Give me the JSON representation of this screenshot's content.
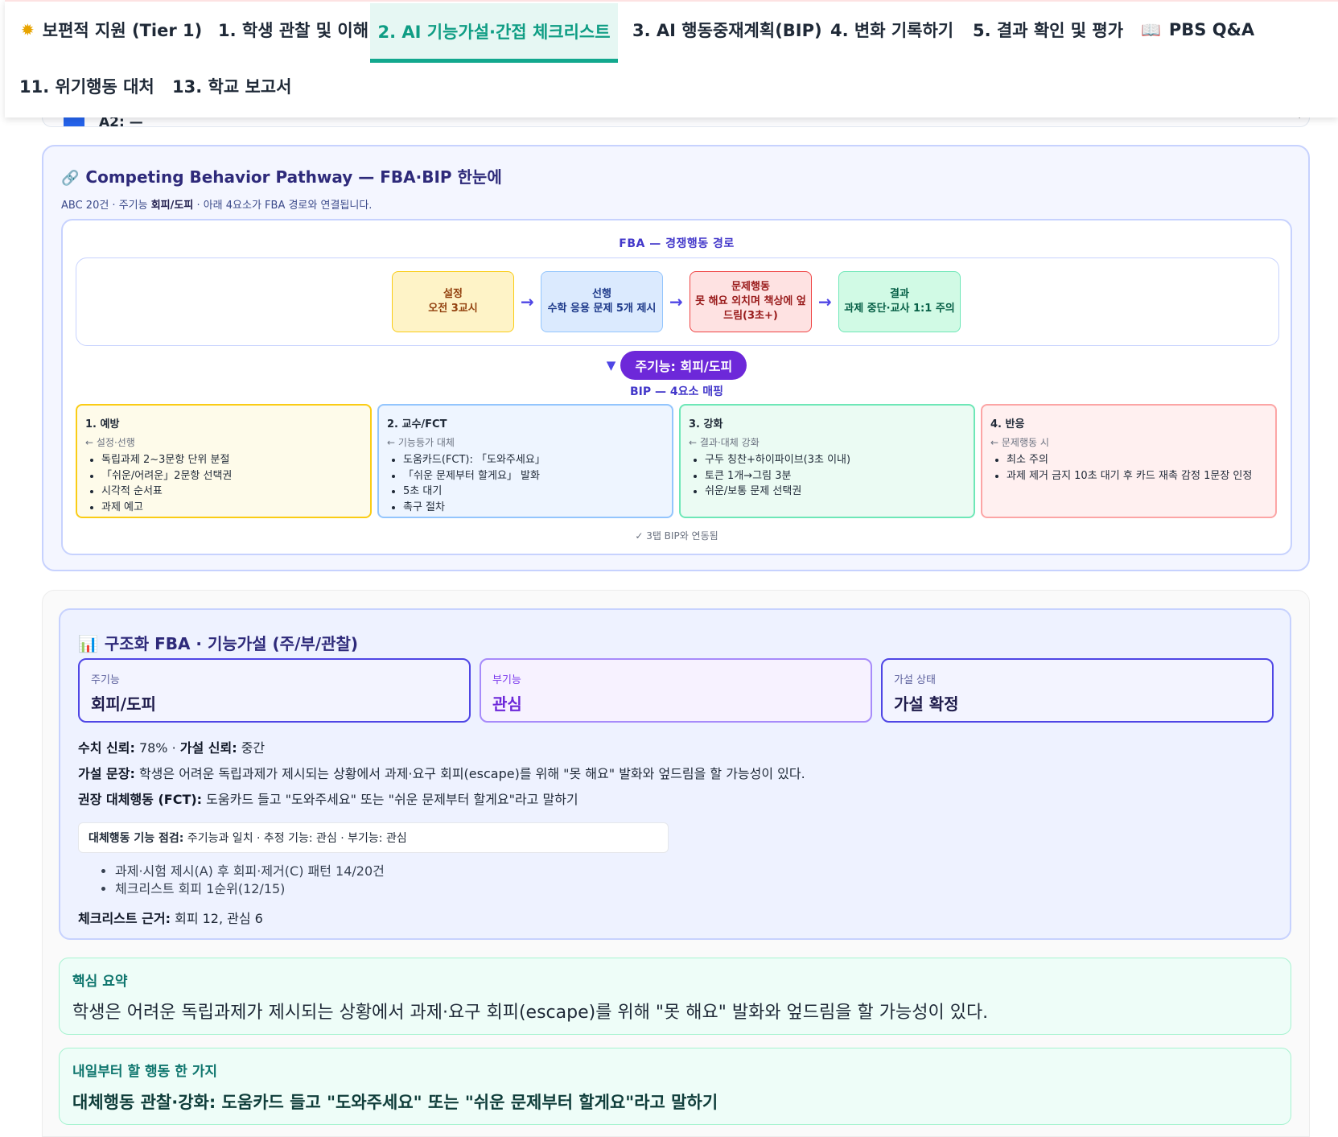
{
  "tabs": [
    {
      "label": "보편적 지원 (Tier 1)",
      "icon": "sun-icon"
    },
    {
      "label": "1. 학생 관찰 및 이해"
    },
    {
      "label": "2. AI 기능가설·간접 체크리스트",
      "active": true
    },
    {
      "label": "3. AI 행동중재계획(BIP)"
    },
    {
      "label": "4. 변화 기록하기"
    },
    {
      "label": "5. 결과 확인 및 평가"
    },
    {
      "label": "PBS Q&A",
      "icon": "book-icon"
    },
    {
      "label": "11. 위기행동 대처"
    },
    {
      "label": "13. 학교 보고서"
    }
  ],
  "peek_row": {
    "label": "A2: —"
  },
  "pathway": {
    "title": "Competing Behavior Pathway — FBA·BIP 한눈에",
    "subtitle_prefix": "ABC 20건 · 주기능 ",
    "subtitle_function": "회피/도피",
    "subtitle_suffix": " · 아래 4요소가 FBA 경로와 연결됩니다.",
    "fba_label": "FBA — 경쟁행동 경로",
    "chain": [
      {
        "title": "설정",
        "text": "오전 3교시"
      },
      {
        "title": "선행",
        "text": "수학 응용 문제 5개 제시"
      },
      {
        "title": "문제행동",
        "text": "못 해요 외치며 책상에 엎드림(3초+)"
      },
      {
        "title": "결과",
        "text": "과제 중단·교사 1:1 주의"
      }
    ],
    "arrow": "→",
    "function_pill": "주기능: 회피/도피",
    "bip_label": "BIP — 4요소 매핑",
    "bip": [
      {
        "title": "1. 예방",
        "from": "← 설정·선행",
        "items": [
          "독립과제 2~3문항 단위 분절",
          "「쉬운/어려운」2문항 선택권",
          "시각적 순서표",
          "과제 예고"
        ]
      },
      {
        "title": "2. 교수/FCT",
        "from": "← 기능등가 대체",
        "items": [
          "도움카드(FCT): 「도와주세요」",
          "「쉬운 문제부터 할게요」 발화",
          "5초 대기",
          "촉구 절차"
        ]
      },
      {
        "title": "3. 강화",
        "from": "← 결과·대체 강화",
        "items": [
          "구두 칭찬+하이파이브(3초 이내)",
          "토큰 1개→그림 3분",
          "쉬운/보통 문제 선택권"
        ]
      },
      {
        "title": "4. 반응",
        "from": "← 문제행동 시",
        "items": [
          "최소 주의",
          "과제 제거 금지 10초 대기 후 카드 재촉 감정 1문장 인정"
        ]
      }
    ],
    "sync_note": "✓ 3탭 BIP와 연동됨"
  },
  "fba": {
    "title": "구조화 FBA · 기능가설 (주/부/관찰)",
    "stats": [
      {
        "label": "주기능",
        "value": "회피/도피"
      },
      {
        "label": "부기능",
        "value": "관심"
      },
      {
        "label": "가설 상태",
        "value": "가설 확정"
      }
    ],
    "confidence_label": "수치 신뢰:",
    "confidence_value": " 78% · ",
    "hypo_conf_label": "가설 신뢰:",
    "hypo_conf_value": " 중간",
    "statement_label": "가설 문장:",
    "statement": " 학생은 어려운 독립과제가 제시되는 상황에서 과제·요구 회피(escape)를 위해 \"못 해요\" 발화와 엎드림을 할 가능성이 있다.",
    "fct_label": "권장 대체행동 (FCT):",
    "fct": " 도움카드 들고 \"도와주세요\" 또는 \"쉬운 문제부터 할게요\"라고 말하기",
    "check_label": "대체행동 기능 점검:",
    "check_text": " 주기능과 일치 · 추정 기능: 관심 · 부기능: 관심",
    "evidence": [
      "과제·시험 제시(A) 후 회피·제거(C) 패턴 14/20건",
      "체크리스트 회피 1순위(12/15)"
    ],
    "checklist_label": "체크리스트 근거:",
    "checklist_text": " 회피 12, 관심 6"
  },
  "summary": {
    "label": "핵심 요약",
    "text": "학생은 어려운 독립과제가 제시되는 상황에서 과제·요구 회피(escape)를 위해 \"못 해요\" 발화와 엎드림을 할 가능성이 있다."
  },
  "action": {
    "label": "내일부터 할 행동 한 가지",
    "text": "대체행동 관찰·강화: 도움카드 들고 \"도와주세요\" 또는 \"쉬운 문제부터 할게요\"라고 말하기"
  },
  "colors": {
    "accent_teal": "#12a88e",
    "primary_indigo": "#4f46e5",
    "function_pill": "#6d28d9"
  }
}
